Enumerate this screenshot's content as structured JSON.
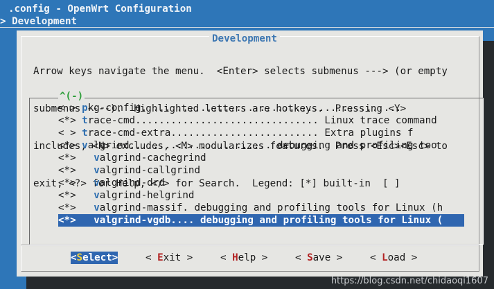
{
  "header": {
    "title": ".config - OpenWrt Configuration",
    "breadcrumb": "> Development"
  },
  "dialog": {
    "title": "Development",
    "help_lines": [
      "Arrow keys navigate the menu.  <Enter> selects submenus ---> (or empty",
      "submenus ----).  Highlighted letters are hotkeys.  Pressing <Y>",
      "includes, <N> excludes, <M> modularizes features.  Press <Esc><Esc> to",
      "exit, <?> for Help, </> for Search.  Legend: [*] built-in  [ ]"
    ],
    "scroll_indicator": "^(-)"
  },
  "menu": {
    "items": [
      {
        "state": "< >",
        "indent": " ",
        "hotkey": "p",
        "rest": "kg-config............................................",
        "selected": false
      },
      {
        "state": "<*>",
        "indent": " ",
        "hotkey": "t",
        "rest": "race-cmd............................... Linux trace command",
        "selected": false
      },
      {
        "state": "< >",
        "indent": " ",
        "hotkey": "t",
        "rest": "race-cmd-extra......................... Extra plugins f",
        "selected": false
      },
      {
        "state": "<*>",
        "indent": " ",
        "hotkey": "v",
        "rest": "algrind........................ debugging and profiling too",
        "selected": false
      },
      {
        "state": "<*>",
        "indent": "   ",
        "hotkey": "v",
        "rest": "algrind-cachegrind",
        "selected": false
      },
      {
        "state": "<*>",
        "indent": "   ",
        "hotkey": "v",
        "rest": "algrind-callgrind",
        "selected": false
      },
      {
        "state": "<*>",
        "indent": "   ",
        "hotkey": "v",
        "rest": "algrind-drd",
        "selected": false
      },
      {
        "state": "<*>",
        "indent": "   ",
        "hotkey": "v",
        "rest": "algrind-helgrind",
        "selected": false
      },
      {
        "state": "<*>",
        "indent": "   ",
        "hotkey": "v",
        "rest": "algrind-massif. debugging and profiling tools for Linux (h",
        "selected": false
      },
      {
        "state": "<*>",
        "indent": "   ",
        "hotkey": "v",
        "rest": "algrind-vgdb.... debugging and profiling tools for Linux (",
        "selected": true
      }
    ]
  },
  "buttons": [
    {
      "pre": "<",
      "hotkey": "S",
      "post": "elect>",
      "active": true
    },
    {
      "pre": "< ",
      "hotkey": "E",
      "post": "xit >",
      "active": false
    },
    {
      "pre": "< ",
      "hotkey": "H",
      "post": "elp >",
      "active": false
    },
    {
      "pre": "< ",
      "hotkey": "S",
      "post": "ave >",
      "active": false
    },
    {
      "pre": "< ",
      "hotkey": "L",
      "post": "oad >",
      "active": false
    }
  ],
  "watermark": "https://blog.csdn.net/chidaoqi1607",
  "colors": {
    "background": "#2e76b8",
    "dialog": "#e6e6e3",
    "selection": "#2f66b0",
    "scroll_indicator": "#2e9e3a",
    "button_hotkey": "#b22222"
  }
}
